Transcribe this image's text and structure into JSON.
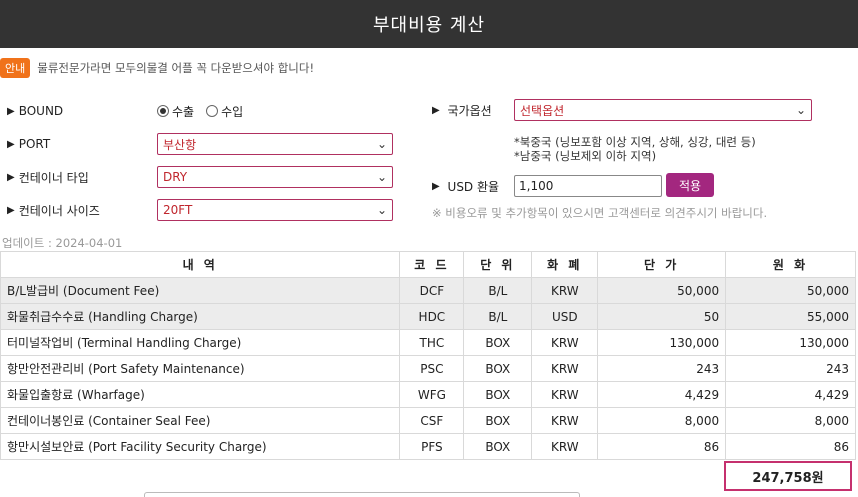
{
  "header": {
    "title": "부대비용 계산"
  },
  "notice": {
    "badge": "안내",
    "text": "물류전문가라면 모두의물결 어플 꼭 다운받으셔야 합니다!"
  },
  "form": {
    "bound": {
      "label": "BOUND",
      "options": [
        "수출",
        "수입"
      ],
      "selected": "수출"
    },
    "port": {
      "label": "PORT",
      "value": "부산항"
    },
    "container_type": {
      "label": "컨테이너 타입",
      "value": "DRY"
    },
    "container_size": {
      "label": "컨테이너 사이즈",
      "value": "20FT"
    },
    "country_option": {
      "label": "국가옵션",
      "value": "선택옵션"
    },
    "country_notes": [
      "*북중국 (닝보포함 이상 지역, 상해, 싱강, 대련 등)",
      "*남중국 (닝보제외 이하 지역)"
    ],
    "usd_rate": {
      "label": "USD 환율",
      "value": "1,100",
      "button": "적용"
    },
    "warning": "※ 비용오류 및 추가항목이 있으시면 고객센터로 의견주시기 바랍니다."
  },
  "updated": "업데이트 : 2024-04-01",
  "table": {
    "headers": [
      "내 역",
      "코 드",
      "단 위",
      "화 폐",
      "단 가",
      "원 화"
    ],
    "rows": [
      {
        "item": "B/L발급비 (Document Fee)",
        "code": "DCF",
        "unit": "B/L",
        "currency": "KRW",
        "price": "50,000",
        "krw": "50,000"
      },
      {
        "item": "화물취급수수료 (Handling Charge)",
        "code": "HDC",
        "unit": "B/L",
        "currency": "USD",
        "price": "50",
        "krw": "55,000"
      },
      {
        "item": "터미널작업비 (Terminal Handling Charge)",
        "code": "THC",
        "unit": "BOX",
        "currency": "KRW",
        "price": "130,000",
        "krw": "130,000"
      },
      {
        "item": "항만안전관리비 (Port Safety Maintenance)",
        "code": "PSC",
        "unit": "BOX",
        "currency": "KRW",
        "price": "243",
        "krw": "243"
      },
      {
        "item": "화물입출항료 (Wharfage)",
        "code": "WFG",
        "unit": "BOX",
        "currency": "KRW",
        "price": "4,429",
        "krw": "4,429"
      },
      {
        "item": "컨테이너봉인료 (Container Seal Fee)",
        "code": "CSF",
        "unit": "BOX",
        "currency": "KRW",
        "price": "8,000",
        "krw": "8,000"
      },
      {
        "item": "항만시설보안료 (Port Facility Security Charge)",
        "code": "PFS",
        "unit": "BOX",
        "currency": "KRW",
        "price": "86",
        "krw": "86"
      }
    ],
    "total": "247,758원"
  },
  "colors": {
    "header_bg": "#333333",
    "accent": "#a3277f",
    "select_text": "#c0262d",
    "badge": "#f0721a"
  }
}
